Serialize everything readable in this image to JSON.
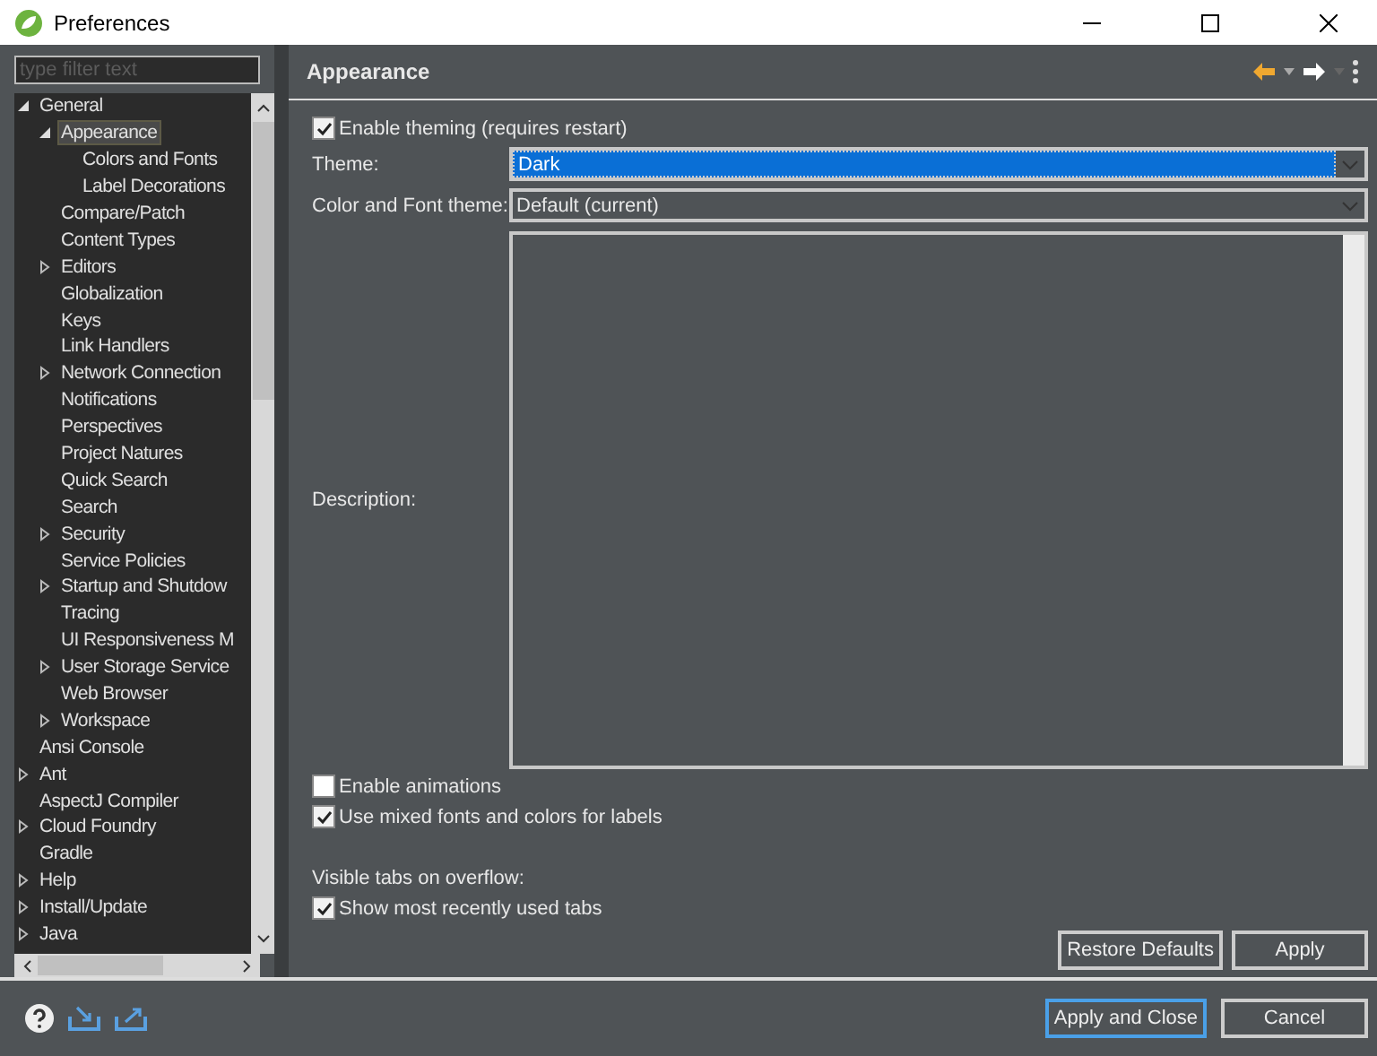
{
  "window": {
    "title": "Preferences"
  },
  "filter": {
    "placeholder": "type filter text"
  },
  "tree": [
    {
      "label": "General",
      "expanded": true,
      "selected": false,
      "children": [
        {
          "label": "Appearance",
          "expanded": true,
          "selected": true,
          "children": [
            {
              "label": "Colors and Fonts",
              "selected": false
            },
            {
              "label": "Label Decorations",
              "selected": false
            }
          ]
        },
        {
          "label": "Compare/Patch",
          "selected": false
        },
        {
          "label": "Content Types",
          "selected": false
        },
        {
          "label": "Editors",
          "expanded": false,
          "selected": false
        },
        {
          "label": "Globalization",
          "selected": false
        },
        {
          "label": "Keys",
          "selected": false
        },
        {
          "label": "Link Handlers",
          "selected": false
        },
        {
          "label": "Network Connection",
          "expanded": false,
          "selected": false
        },
        {
          "label": "Notifications",
          "selected": false
        },
        {
          "label": "Perspectives",
          "selected": false
        },
        {
          "label": "Project Natures",
          "selected": false
        },
        {
          "label": "Quick Search",
          "selected": false
        },
        {
          "label": "Search",
          "selected": false
        },
        {
          "label": "Security",
          "expanded": false,
          "selected": false
        },
        {
          "label": "Service Policies",
          "selected": false
        },
        {
          "label": "Startup and Shutdow",
          "expanded": false,
          "selected": false
        },
        {
          "label": "Tracing",
          "selected": false
        },
        {
          "label": "UI Responsiveness M",
          "selected": false
        },
        {
          "label": "User Storage Service",
          "expanded": false,
          "selected": false
        },
        {
          "label": "Web Browser",
          "selected": false
        },
        {
          "label": "Workspace",
          "expanded": false,
          "selected": false
        }
      ]
    },
    {
      "label": "Ansi Console",
      "selected": false
    },
    {
      "label": "Ant",
      "expanded": false,
      "selected": false
    },
    {
      "label": "AspectJ Compiler",
      "selected": false
    },
    {
      "label": "Cloud Foundry",
      "expanded": false,
      "selected": false
    },
    {
      "label": "Gradle",
      "selected": false
    },
    {
      "label": "Help",
      "expanded": false,
      "selected": false
    },
    {
      "label": "Install/Update",
      "expanded": false,
      "selected": false
    },
    {
      "label": "Java",
      "expanded": false,
      "selected": false
    }
  ],
  "page": {
    "title": "Appearance",
    "enable_theming": {
      "label": "Enable theming (requires restart)",
      "checked": true
    },
    "theme": {
      "label": "Theme:",
      "value": "Dark"
    },
    "color_font_theme": {
      "label": "Color and Font theme:",
      "value": "Default (current)"
    },
    "description": {
      "label": "Description:"
    },
    "options": [
      {
        "label": "Enable animations",
        "checked": false
      },
      {
        "label": "Use mixed fonts and colors for labels",
        "checked": true
      }
    ],
    "tabs_heading": "Visible tabs on overflow:",
    "tabs_option": {
      "label": "Show most recently used tabs",
      "checked": true
    },
    "buttons": [
      "Restore Defaults",
      "Apply"
    ]
  },
  "footer": {
    "buttons": [
      {
        "label": "Apply and Close",
        "kind": "default"
      },
      {
        "label": "Cancel",
        "kind": "normal"
      }
    ]
  }
}
